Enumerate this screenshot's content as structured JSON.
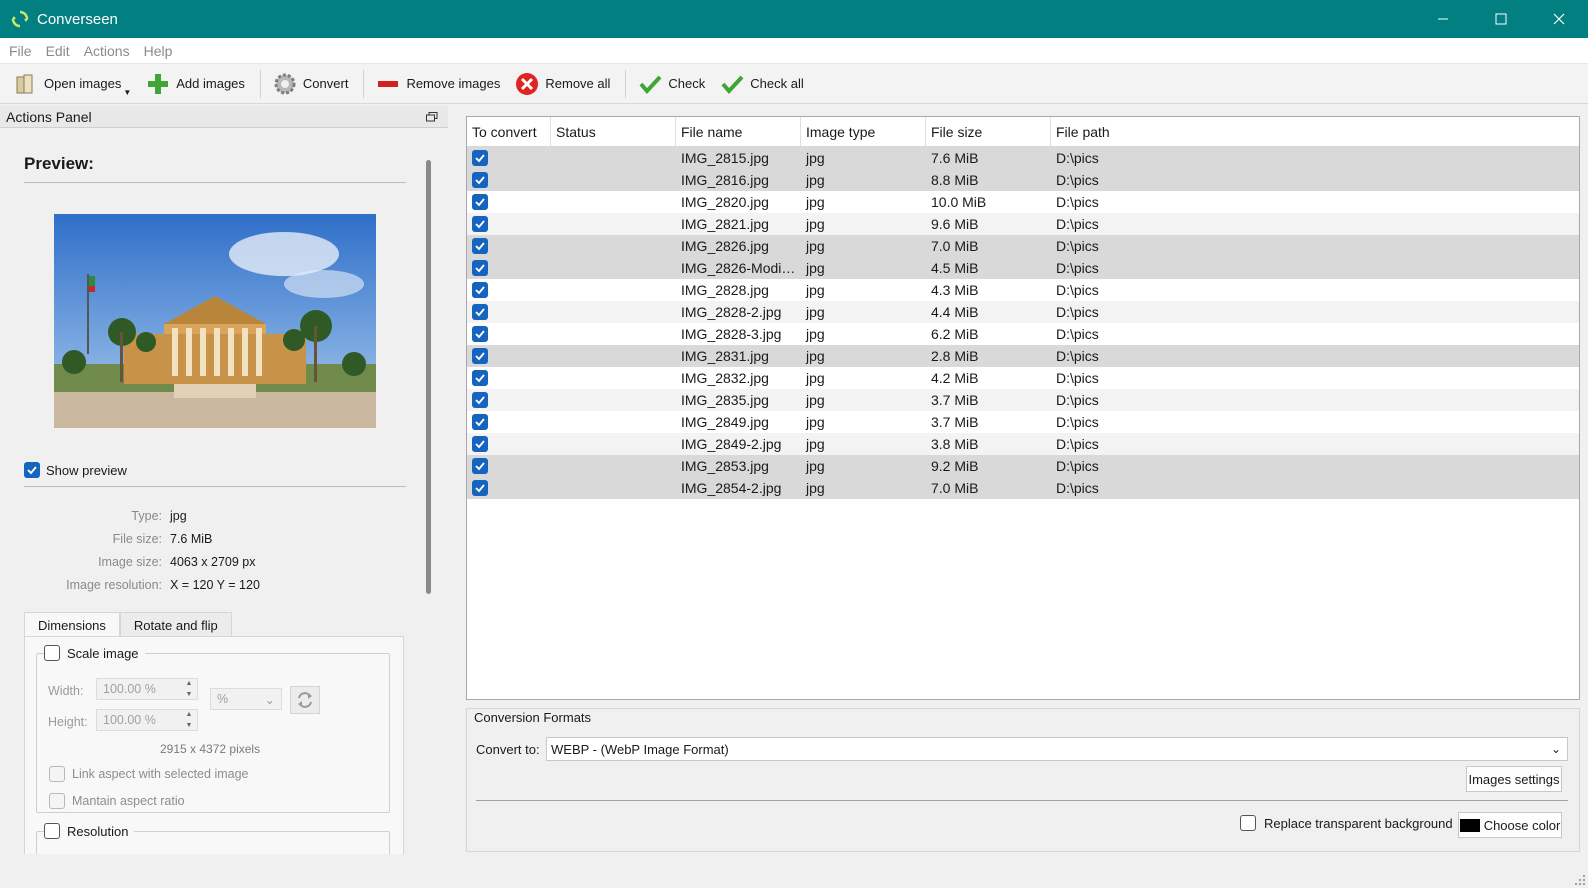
{
  "window": {
    "title": "Converseen",
    "accent": "#027f80"
  },
  "menu": [
    "File",
    "Edit",
    "Actions",
    "Help"
  ],
  "toolbar": {
    "open_images": "Open images",
    "add_images": "Add images",
    "convert": "Convert",
    "remove_images": "Remove images",
    "remove_all": "Remove all",
    "check": "Check",
    "check_all": "Check all"
  },
  "actions_panel": {
    "title": "Actions Panel",
    "preview_title": "Preview:",
    "show_preview": "Show preview",
    "show_preview_checked": true,
    "info": {
      "type_label": "Type:",
      "type_value": "jpg",
      "size_label": "File size:",
      "size_value": "7.6 MiB",
      "dims_label": "Image size:",
      "dims_value": "4063 x 2709 px",
      "res_label": "Image resolution:",
      "res_value": "X = 120 Y = 120"
    },
    "tabs": [
      "Dimensions",
      "Rotate and flip"
    ],
    "scale": {
      "title": "Scale image",
      "checked": false,
      "width_label": "Width:",
      "width_value": "100.00 %",
      "height_label": "Height:",
      "height_value": "100.00 %",
      "unit": "%",
      "pixels": "2915 x 4372 pixels",
      "link_aspect": "Link aspect with selected image",
      "maintain_aspect": "Mantain aspect ratio"
    },
    "resolution_title": "Resolution"
  },
  "table": {
    "columns": [
      "To convert",
      "Status",
      "File name",
      "Image type",
      "File size",
      "File path"
    ],
    "rows": [
      {
        "checked": true,
        "status": "",
        "name": "IMG_2815.jpg",
        "type": "jpg",
        "size": "7.6 MiB",
        "path": "D:\\pics",
        "bg": "shade"
      },
      {
        "checked": true,
        "status": "",
        "name": "IMG_2816.jpg",
        "type": "jpg",
        "size": "8.8 MiB",
        "path": "D:\\pics",
        "bg": "shade"
      },
      {
        "checked": true,
        "status": "",
        "name": "IMG_2820.jpg",
        "type": "jpg",
        "size": "10.0 MiB",
        "path": "D:\\pics",
        "bg": "white"
      },
      {
        "checked": true,
        "status": "",
        "name": "IMG_2821.jpg",
        "type": "jpg",
        "size": "9.6 MiB",
        "path": "D:\\pics",
        "bg": "lite"
      },
      {
        "checked": true,
        "status": "",
        "name": "IMG_2826.jpg",
        "type": "jpg",
        "size": "7.0 MiB",
        "path": "D:\\pics",
        "bg": "shade"
      },
      {
        "checked": true,
        "status": "",
        "name": "IMG_2826-Modi…",
        "type": "jpg",
        "size": "4.5 MiB",
        "path": "D:\\pics",
        "bg": "shade"
      },
      {
        "checked": true,
        "status": "",
        "name": "IMG_2828.jpg",
        "type": "jpg",
        "size": "4.3 MiB",
        "path": "D:\\pics",
        "bg": "white"
      },
      {
        "checked": true,
        "status": "",
        "name": "IMG_2828-2.jpg",
        "type": "jpg",
        "size": "4.4 MiB",
        "path": "D:\\pics",
        "bg": "lite"
      },
      {
        "checked": true,
        "status": "",
        "name": "IMG_2828-3.jpg",
        "type": "jpg",
        "size": "6.2 MiB",
        "path": "D:\\pics",
        "bg": "white"
      },
      {
        "checked": true,
        "status": "",
        "name": "IMG_2831.jpg",
        "type": "jpg",
        "size": "2.8 MiB",
        "path": "D:\\pics",
        "bg": "shade"
      },
      {
        "checked": true,
        "status": "",
        "name": "IMG_2832.jpg",
        "type": "jpg",
        "size": "4.2 MiB",
        "path": "D:\\pics",
        "bg": "white"
      },
      {
        "checked": true,
        "status": "",
        "name": "IMG_2835.jpg",
        "type": "jpg",
        "size": "3.7 MiB",
        "path": "D:\\pics",
        "bg": "lite"
      },
      {
        "checked": true,
        "status": "",
        "name": "IMG_2849.jpg",
        "type": "jpg",
        "size": "3.7 MiB",
        "path": "D:\\pics",
        "bg": "white"
      },
      {
        "checked": true,
        "status": "",
        "name": "IMG_2849-2.jpg",
        "type": "jpg",
        "size": "3.8 MiB",
        "path": "D:\\pics",
        "bg": "lite"
      },
      {
        "checked": true,
        "status": "",
        "name": "IMG_2853.jpg",
        "type": "jpg",
        "size": "9.2 MiB",
        "path": "D:\\pics",
        "bg": "shade"
      },
      {
        "checked": true,
        "status": "",
        "name": "IMG_2854-2.jpg",
        "type": "jpg",
        "size": "7.0 MiB",
        "path": "D:\\pics",
        "bg": "shade"
      }
    ]
  },
  "formats": {
    "title": "Conversion Formats",
    "convert_to_label": "Convert to:",
    "convert_to_value": "WEBP - (WebP Image Format)",
    "images_settings": "Images settings",
    "replace_bg": "Replace transparent background",
    "replace_bg_checked": false,
    "choose_color": "Choose color",
    "color": "#000000"
  }
}
